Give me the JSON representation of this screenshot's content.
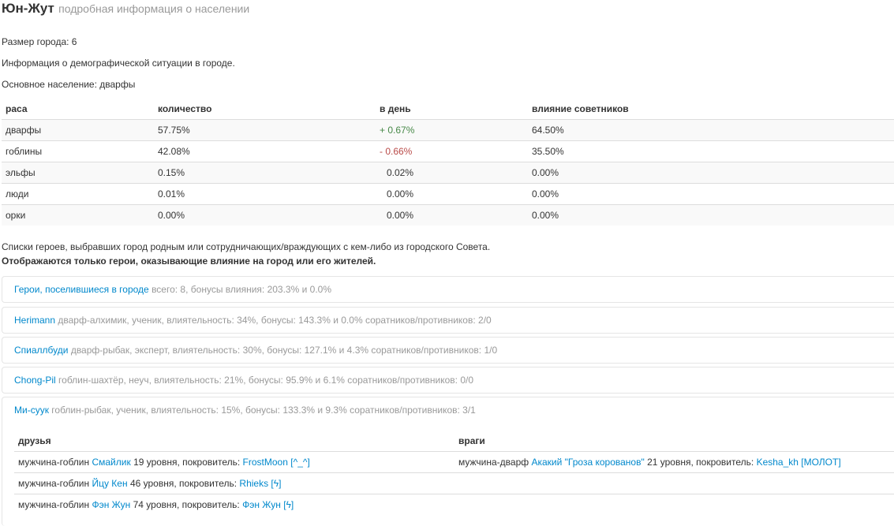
{
  "header": {
    "title": "Юн-Жут",
    "subtitle": "подробная информация о населении"
  },
  "city_size": "Размер города: 6",
  "demographics_info": "Информация о демографической ситуации в городе.",
  "main_population": "Основное население: дварфы",
  "race_table": {
    "headers": [
      "раса",
      "количество",
      "в день",
      "влияние советников"
    ],
    "rows": [
      {
        "race": "дварфы",
        "count": "57.75%",
        "daily": "+ 0.67%",
        "trend": "up",
        "influence": "64.50%"
      },
      {
        "race": "гоблины",
        "count": "42.08%",
        "daily": "- 0.66%",
        "trend": "down",
        "influence": "35.50%"
      },
      {
        "race": "эльфы",
        "count": "0.15%",
        "daily": "0.02%",
        "trend": "none",
        "influence": "0.00%"
      },
      {
        "race": "люди",
        "count": "0.01%",
        "daily": "0.00%",
        "trend": "none",
        "influence": "0.00%"
      },
      {
        "race": "орки",
        "count": "0.00%",
        "daily": "0.00%",
        "trend": "none",
        "influence": "0.00%"
      }
    ]
  },
  "heroes_intro": "Списки героев, выбравших город родным или сотрудничающих/враждующих с кем-либо из городского Совета.",
  "heroes_note": "Отображаются только герои, оказывающие влияние на город или его жителей.",
  "accordion": [
    {
      "link": "Герои, поселившиеся в городе",
      "text": "всего: 8, бонусы влияния: 203.3% и 0.0%"
    },
    {
      "link": "Herimann",
      "text": "дварф-алхимик, ученик, влиятельность: 34%, бонусы: 143.3% и 0.0% соратников/противников: 2/0"
    },
    {
      "link": "Спиаллбуди",
      "text": "дварф-рыбак, эксперт, влиятельность: 30%, бонусы: 127.1% и 4.3% соратников/противников: 1/0"
    },
    {
      "link": "Chong-Pil",
      "text": "гоблин-шахтёр, неуч, влиятельность: 21%, бонусы: 95.9% и 6.1% соратников/противников: 0/0"
    },
    {
      "link": "Ми-суук",
      "text": "гоблин-рыбак, ученик, влиятельность: 15%, бонусы: 133.3% и 9.3% соратников/противников: 3/1"
    }
  ],
  "relations": {
    "headers": [
      "друзья",
      "враги"
    ],
    "rows": [
      {
        "friend": {
          "prefix": "мужчина-гоблин",
          "name": "Смайлик",
          "mid": "19 уровня, покровитель:",
          "patron": "FrostMoon [^_^]"
        },
        "enemy": {
          "prefix": "мужчина-дварф",
          "name": "Акакий \"Гроза корованов\"",
          "mid": "21 уровня, покровитель:",
          "patron": "Kesha_kh [МОЛОТ]"
        }
      },
      {
        "friend": {
          "prefix": "мужчина-гоблин",
          "name": "Йцу Кен",
          "mid": "46 уровня, покровитель:",
          "patron": "Rhieks [ϟ]"
        }
      },
      {
        "friend": {
          "prefix": "мужчина-гоблин",
          "name": "Фэн Жун",
          "mid": "74 уровня, покровитель:",
          "patron": "Фэн Жун [ϟ]"
        }
      }
    ]
  }
}
